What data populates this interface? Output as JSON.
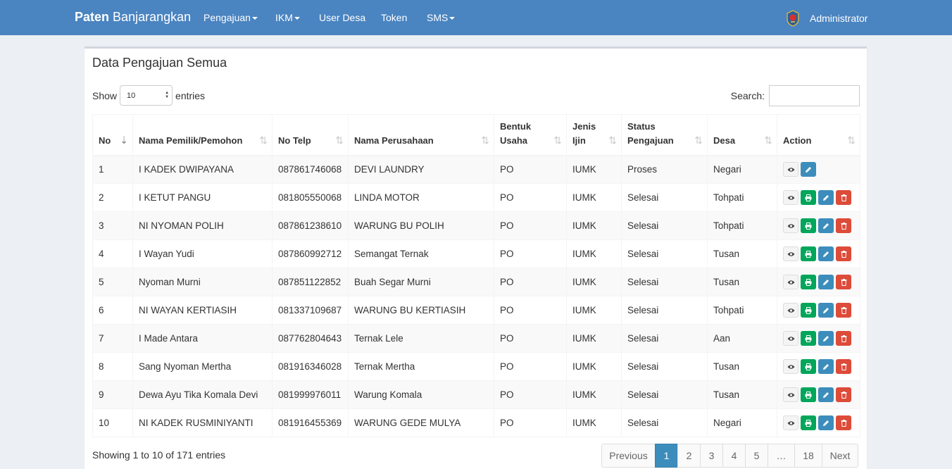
{
  "navbar": {
    "brand_bold": "Paten",
    "brand_rest": "Banjarangkan",
    "items": [
      {
        "label": "Pengajuan"
      },
      {
        "label": "IKM"
      },
      {
        "label": "User Desa"
      },
      {
        "label": "Token"
      },
      {
        "label": "SMS"
      }
    ],
    "user": "Administrator"
  },
  "box": {
    "title": "Data Pengajuan Semua",
    "show_label": "Show",
    "entries_value": "10",
    "entries_label": "entries",
    "search_label": "Search:",
    "search_value": ""
  },
  "table": {
    "headers": [
      "No",
      "Nama Pemilik/Pemohon",
      "No Telp",
      "Nama Perusahaan",
      "Bentuk Usaha",
      "Jenis Ijin",
      "Status Pengajuan",
      "Desa",
      "Action"
    ],
    "rows": [
      {
        "no": "1",
        "nama": "I KADEK DWIPAYANA",
        "telp": "087861746068",
        "perusahaan": "DEVI LAUNDRY",
        "bentuk": "PO",
        "jenis": "IUMK",
        "status": "Proses",
        "desa": "Negari"
      },
      {
        "no": "2",
        "nama": "I KETUT PANGU",
        "telp": "081805550068",
        "perusahaan": "LINDA MOTOR",
        "bentuk": "PO",
        "jenis": "IUMK",
        "status": "Selesai",
        "desa": "Tohpati"
      },
      {
        "no": "3",
        "nama": "NI NYOMAN POLIH",
        "telp": "087861238610",
        "perusahaan": "WARUNG BU POLIH",
        "bentuk": "PO",
        "jenis": "IUMK",
        "status": "Selesai",
        "desa": "Tohpati"
      },
      {
        "no": "4",
        "nama": "I Wayan Yudi",
        "telp": "087860992712",
        "perusahaan": "Semangat Ternak",
        "bentuk": "PO",
        "jenis": "IUMK",
        "status": "Selesai",
        "desa": "Tusan"
      },
      {
        "no": "5",
        "nama": "Nyoman Murni",
        "telp": "087851122852",
        "perusahaan": "Buah Segar Murni",
        "bentuk": "PO",
        "jenis": "IUMK",
        "status": "Selesai",
        "desa": "Tusan"
      },
      {
        "no": "6",
        "nama": "NI WAYAN KERTIASIH",
        "telp": "081337109687",
        "perusahaan": "WARUNG BU KERTIASIH",
        "bentuk": "PO",
        "jenis": "IUMK",
        "status": "Selesai",
        "desa": "Tohpati"
      },
      {
        "no": "7",
        "nama": "I Made Antara",
        "telp": "087762804643",
        "perusahaan": "Ternak Lele",
        "bentuk": "PO",
        "jenis": "IUMK",
        "status": "Selesai",
        "desa": "Aan"
      },
      {
        "no": "8",
        "nama": "Sang Nyoman Mertha",
        "telp": "081916346028",
        "perusahaan": "Ternak Mertha",
        "bentuk": "PO",
        "jenis": "IUMK",
        "status": "Selesai",
        "desa": "Tusan"
      },
      {
        "no": "9",
        "nama": "Dewa Ayu Tika Komala Devi",
        "telp": "081999976011",
        "perusahaan": "Warung Komala",
        "bentuk": "PO",
        "jenis": "IUMK",
        "status": "Selesai",
        "desa": "Tusan"
      },
      {
        "no": "10",
        "nama": "NI KADEK RUSMINIYANTI",
        "telp": "081916455369",
        "perusahaan": "WARUNG GEDE MULYA",
        "bentuk": "PO",
        "jenis": "IUMK",
        "status": "Selesai",
        "desa": "Negari"
      }
    ]
  },
  "footer": {
    "info": "Showing 1 to 10 of 171 entries",
    "previous": "Previous",
    "pages": [
      "1",
      "2",
      "3",
      "4",
      "5",
      "…",
      "18"
    ],
    "next": "Next",
    "active_page": "1"
  },
  "colors": {
    "navbar": "#4a84c1",
    "print": "#00a65a",
    "edit": "#3c8dbc",
    "delete": "#dd4b39"
  }
}
